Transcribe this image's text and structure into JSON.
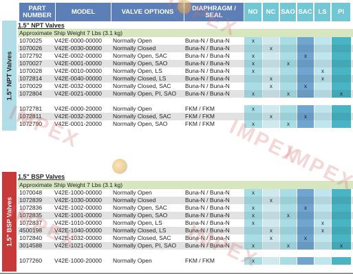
{
  "header": {
    "part_number": "PART NUMBER",
    "model": "MODEL",
    "valve_options": "VALVE OPTIONS",
    "diaphragm": "DIAPHRAGM / SEAL",
    "flags": [
      "NO",
      "NC",
      "SAO",
      "SAC",
      "LS",
      "PI"
    ]
  },
  "colors": {
    "header_blue": "#5d7fb7",
    "header_teal": "#71c7d3",
    "npt_side": "#b0dde6",
    "bsp_side": "#c83a3a",
    "ship_band": "#d7e6bf",
    "watermark": "#d77070"
  },
  "watermarks": [
    "IMPEX",
    "IMPEX",
    "IMPEX",
    "IMPEX",
    "IMPEX",
    "IMPEX"
  ],
  "npt": {
    "side_label": "1.5\" NPT Valves",
    "title": "1.5\" NPT Valves",
    "ship": "Approximate Ship Weight 7 Lbs (3.1 kg)",
    "rows": [
      {
        "part": "1070025",
        "model": "V42E-0000-00000",
        "option": "Normally Open",
        "diaphragm": "Buna-N / Buna-N",
        "flags": [
          "x",
          "",
          "",
          "",
          "",
          ""
        ]
      },
      {
        "part": "1070026",
        "model": "V42E-0030-00000",
        "option": "Normally Closed",
        "diaphragm": "Buna-N / Buna-N",
        "flags": [
          "",
          "x",
          "",
          "",
          "",
          ""
        ]
      },
      {
        "part": "1072792",
        "model": "V42E-0002-00000",
        "option": "Normally Open, SAC",
        "diaphragm": "Buna-N / Buna-N",
        "flags": [
          "x",
          "",
          "",
          "x",
          "",
          ""
        ]
      },
      {
        "part": "1070027",
        "model": "V42E-0001-00000",
        "option": "Normally Open, SAO",
        "diaphragm": "Buna-N / Buna-N",
        "flags": [
          "x",
          "",
          "x",
          "",
          "",
          ""
        ]
      },
      {
        "part": "1070028",
        "model": "V42E-0010-00000",
        "option": "Normally Open, LS",
        "diaphragm": "Buna-N / Buna-N",
        "flags": [
          "x",
          "",
          "",
          "",
          "x",
          ""
        ]
      },
      {
        "part": "1072814",
        "model": "V42E-0040-00000",
        "option": "Normally Closed, LS",
        "diaphragm": "Buna-N / Buna-N",
        "flags": [
          "",
          "x",
          "",
          "",
          "x",
          ""
        ]
      },
      {
        "part": "1070029",
        "model": "V42E-0032-00000",
        "option": "Normally Closed, SAC",
        "diaphragm": "Buna-N / Buna-N",
        "flags": [
          "",
          "x",
          "",
          "x",
          "",
          ""
        ]
      },
      {
        "part": "1072804",
        "model": "V42E-0021-00000",
        "option": "Normally Open, PI, SAO",
        "diaphragm": "Buna-N / Buna-N",
        "flags": [
          "x",
          "",
          "x",
          "",
          "",
          "x"
        ]
      },
      {
        "part": "1072781",
        "model": "V42E-0000-20000",
        "option": "Normally Open",
        "diaphragm": "FKM / FKM",
        "flags": [
          "x",
          "",
          "",
          "",
          "",
          ""
        ]
      },
      {
        "part": "1072811",
        "model": "V42E-0032-20000",
        "option": "Normally Closed, SAC",
        "diaphragm": "FKM / FKM",
        "flags": [
          "",
          "x",
          "",
          "x",
          "",
          ""
        ]
      },
      {
        "part": "1072790",
        "model": "V42E-0001-20000",
        "option": "Normally Open, SAO",
        "diaphragm": "FKM / FKM",
        "flags": [
          "x",
          "",
          "x",
          "",
          "",
          ""
        ]
      }
    ]
  },
  "bsp": {
    "side_label": "1.5\" BSP Valves",
    "title": "1.5\" BSP Valves",
    "ship": "Approximate Ship Weight 7 Lbs (3.1 kg)",
    "rows": [
      {
        "part": "1070048",
        "model": "V42E-1000-00000",
        "option": "Normally Open",
        "diaphragm": "Buna-N / Buna-N",
        "flags": [
          "x",
          "",
          "",
          "",
          "",
          ""
        ]
      },
      {
        "part": "1072839",
        "model": "V42E-1030-00000",
        "option": "Normally Closed",
        "diaphragm": "Buna-N / Buna-N",
        "flags": [
          "",
          "x",
          "",
          "",
          "",
          ""
        ]
      },
      {
        "part": "1072836",
        "model": "V42E-1002-00000",
        "option": "Normally Open, SAC",
        "diaphragm": "Buna-N / Buna-N",
        "flags": [
          "x",
          "",
          "",
          "x",
          "",
          ""
        ]
      },
      {
        "part": "1072835",
        "model": "V42E-1001-00000",
        "option": "Normally Open, SAO",
        "diaphragm": "Buna-N / Buna-N",
        "flags": [
          "x",
          "",
          "x",
          "",
          "",
          ""
        ]
      },
      {
        "part": "1072837",
        "model": "V42E-1010-00000",
        "option": "Normally Open, LS",
        "diaphragm": "Buna-N / Buna-N",
        "flags": [
          "x",
          "",
          "",
          "",
          "x",
          ""
        ]
      },
      {
        "part": "4500198",
        "model": "V42E-1040-00000",
        "option": "Normally Closed, LS",
        "diaphragm": "Buna-N / Buna-N",
        "flags": [
          "",
          "x",
          "",
          "",
          "x",
          ""
        ]
      },
      {
        "part": "1072840",
        "model": "V42E-1032-00000",
        "option": "Normally Closed, SAC",
        "diaphragm": "Buna-N / Buna-N",
        "flags": [
          "",
          "x",
          "",
          "x",
          "",
          ""
        ]
      },
      {
        "part": "3014588",
        "model": "V42E-1021-00000",
        "option": "Normally Open, PI, SAO",
        "diaphragm": "Buna-N / Buna-N",
        "flags": [
          "x",
          "",
          "x",
          "",
          "",
          "x"
        ]
      },
      {
        "part": "1077260",
        "model": "V42E-1000-20000",
        "option": "Normally Open",
        "diaphragm": "FKM / FKM",
        "flags": [
          "x",
          "",
          "",
          "",
          "",
          ""
        ]
      }
    ]
  }
}
